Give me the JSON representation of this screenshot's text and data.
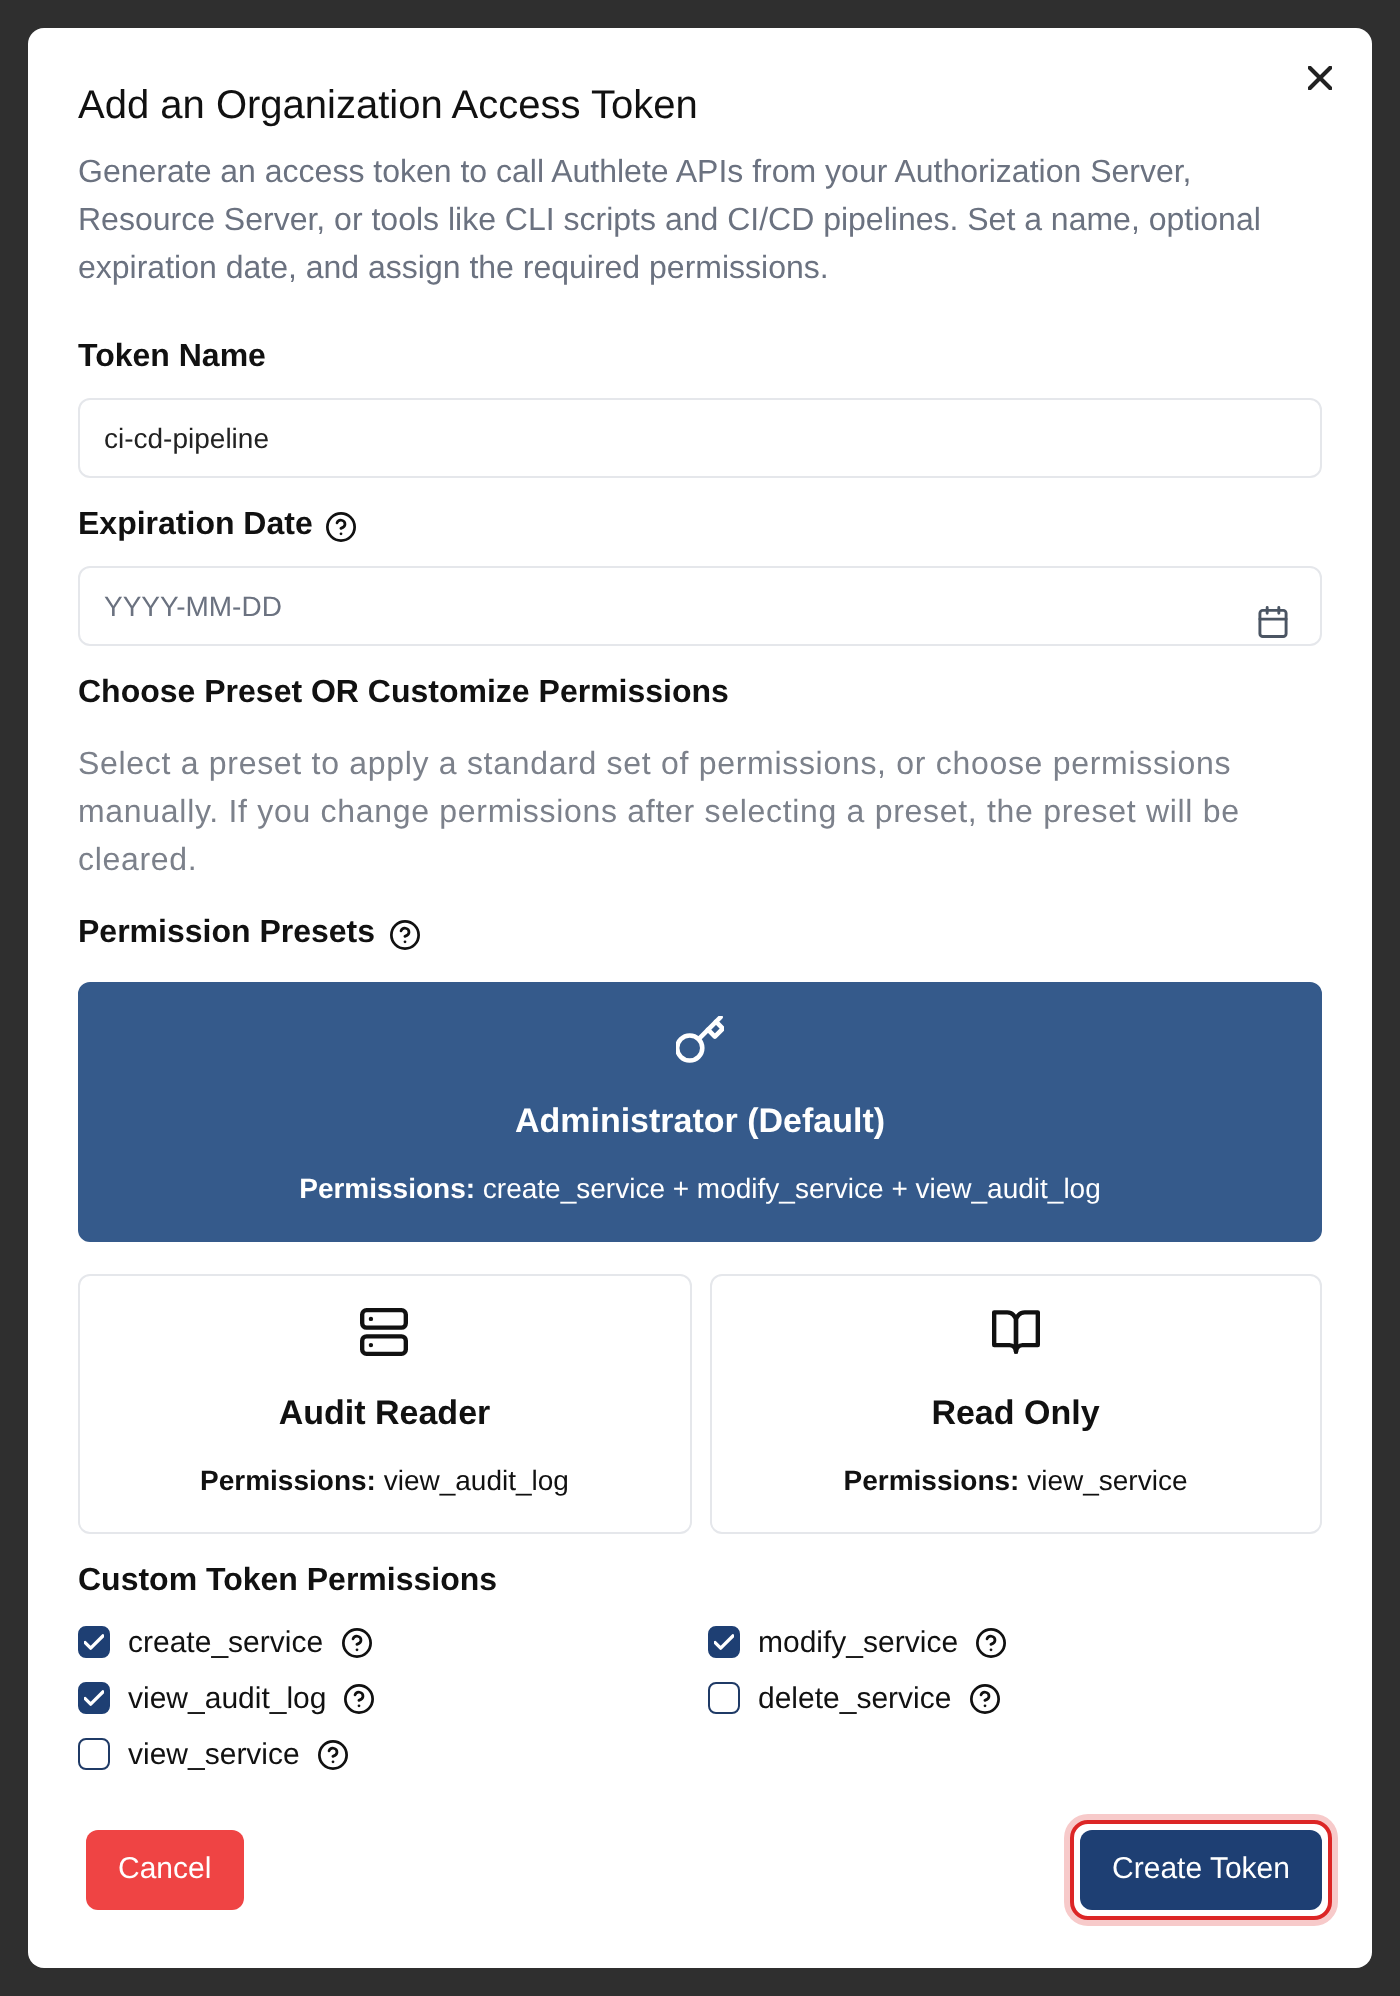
{
  "dialog": {
    "title": "Add an Organization Access Token",
    "description": "Generate an access token to call Authlete APIs from your Authorization Server, Resource Server, or tools like CLI scripts and CI/CD pipelines. Set a name, optional expiration date, and assign the required permissions."
  },
  "fields": [
    {
      "kind": "text",
      "label": "Token Name",
      "value": "ci-cd-pipeline"
    },
    {
      "kind": "date",
      "label": "Expiration Date",
      "placeholder": "YYYY-MM-DD",
      "help": true
    }
  ],
  "permissions_section": {
    "heading": "Choose Preset OR Customize Permissions",
    "description": "Select a preset to apply a standard set of permissions, or choose permissions manually. If you change permissions after selecting a preset, the preset will be cleared."
  },
  "presets": {
    "heading": "Permission Presets",
    "help": true,
    "items": [
      {
        "name": "Administrator (Default)",
        "permissions": "**Permissions:** create_service + modify_service + view_audit_log",
        "selected": true
      },
      {
        "name": "Audit Reader",
        "permissions": "**Permissions:** view_audit_log",
        "selected": false
      },
      {
        "name": "Read Only",
        "permissions": "**Permissions:** view_service",
        "selected": false
      }
    ]
  },
  "custom_permissions": {
    "heading": "Custom Token Permissions",
    "items": [
      {
        "name": "create_service",
        "checked": true,
        "help": true
      },
      {
        "name": "modify_service",
        "checked": true,
        "help": true
      },
      {
        "name": "view_audit_log",
        "checked": true,
        "help": true
      },
      {
        "name": "delete_service",
        "checked": false,
        "help": true
      },
      {
        "name": "view_service",
        "checked": false,
        "help": true
      }
    ]
  },
  "buttons": [
    {
      "kind": "cancel",
      "label": "Cancel"
    },
    {
      "kind": "submit",
      "label": "Create Token",
      "focused": true
    }
  ]
}
